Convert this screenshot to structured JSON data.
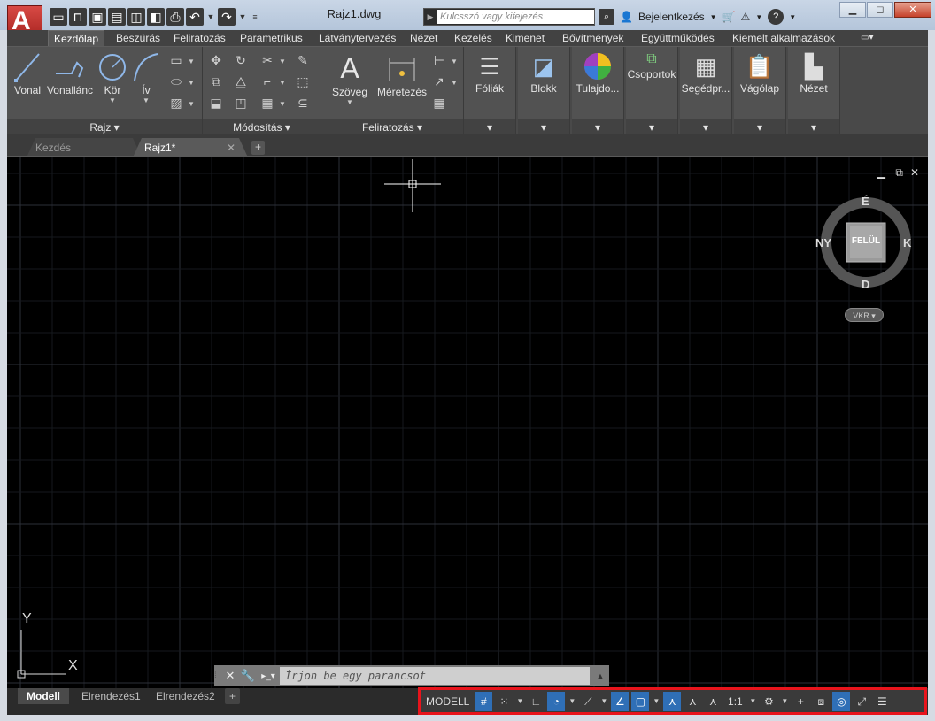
{
  "app": {
    "logo_letter": "A",
    "doc_title": "Rajz1.dwg"
  },
  "search": {
    "placeholder": "Kulcsszó vagy kifejezés"
  },
  "account": {
    "login_label": "Bejelentkezés"
  },
  "ribbon_tabs": [
    "Kezdőlap",
    "Beszúrás",
    "Feliratozás",
    "Parametrikus",
    "Látványtervezés",
    "Nézet",
    "Kezelés",
    "Kimenet",
    "Bővítmények",
    "Együttműködés",
    "Kiemelt alkalmazások"
  ],
  "panels": {
    "rajz": {
      "title": "Rajz",
      "tools": [
        "Vonal",
        "Vonallánc",
        "Kör",
        "Ív"
      ]
    },
    "modositas": {
      "title": "Módosítás"
    },
    "feliratozas": {
      "title": "Feliratozás",
      "tools": [
        "Szöveg",
        "Méretezés"
      ]
    },
    "big_tools": [
      "Fóliák",
      "Blokk",
      "Tulajdo...",
      "Csoportok",
      "Segédpr...",
      "Vágólap",
      "Nézet"
    ]
  },
  "doc_tabs": {
    "start": "Kezdés",
    "current": "Rajz1*"
  },
  "viewcube": {
    "north": "É",
    "south": "D",
    "east": "K",
    "west": "NY",
    "face": "FELÜL",
    "ucs": "VKR"
  },
  "axes": {
    "x": "X",
    "y": "Y"
  },
  "command_line": {
    "placeholder": "Írjon be egy parancsot"
  },
  "layout_tabs": [
    "Modell",
    "Elrendezés1",
    "Elrendezés2"
  ],
  "status": {
    "model": "MODELL",
    "scale": "1:1"
  },
  "colors": {
    "accent": "#2f6fb6",
    "highlight_border": "#e8141c",
    "canvas": "#000000",
    "logo": "#c42b27"
  }
}
